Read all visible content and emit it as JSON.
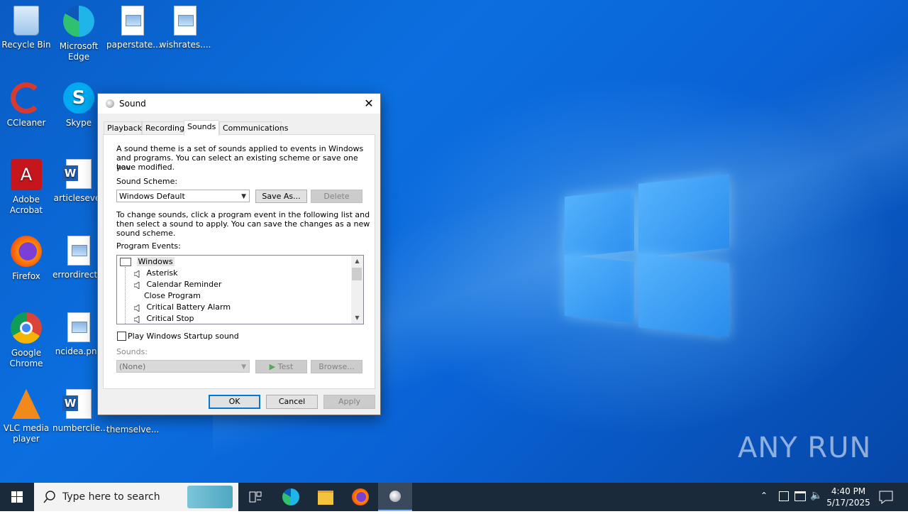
{
  "desktop": {
    "icons": [
      {
        "label": "Recycle Bin"
      },
      {
        "label": "Microsoft Edge"
      },
      {
        "label": "paperstate..."
      },
      {
        "label": "wishrates...."
      },
      {
        "label": "CCleaner"
      },
      {
        "label": "Skype"
      },
      {
        "label": "Adobe Acrobat"
      },
      {
        "label": "articlesever"
      },
      {
        "label": "Firefox"
      },
      {
        "label": "errordirect..."
      },
      {
        "label": "Google Chrome"
      },
      {
        "label": "ncidea.png"
      },
      {
        "label": "VLC media player"
      },
      {
        "label": "numberclie..."
      },
      {
        "label": "themselve..."
      }
    ],
    "watermark": "ANY RUN"
  },
  "dialog": {
    "title": "Sound",
    "close_glyph": "✕",
    "tabs": [
      {
        "label": "Playback"
      },
      {
        "label": "Recording"
      },
      {
        "label": "Sounds"
      },
      {
        "label": "Communications"
      }
    ],
    "intro_lines": [
      "A sound theme is a set of sounds applied to events in Windows",
      "and programs.  You can select an existing scheme or save one you",
      "have modified."
    ],
    "scheme_label": "Sound Scheme:",
    "scheme_value": "Windows Default",
    "save_as_label": "Save As...",
    "delete_label": "Delete",
    "change_lines": [
      "To change sounds, click a program event in the following list and",
      "then select a sound to apply.  You can save the changes as a new",
      "sound scheme."
    ],
    "events_label": "Program Events:",
    "events": [
      {
        "label": "Windows"
      },
      {
        "label": "Asterisk"
      },
      {
        "label": "Calendar Reminder"
      },
      {
        "label": "Close Program"
      },
      {
        "label": "Critical Battery Alarm"
      },
      {
        "label": "Critical Stop"
      }
    ],
    "startup_checkbox_label": "Play Windows Startup sound",
    "sounds_label": "Sounds:",
    "sounds_value": "(None)",
    "test_label": "Test",
    "browse_label": "Browse...",
    "ok_label": "OK",
    "cancel_label": "Cancel",
    "apply_label": "Apply"
  },
  "taskbar": {
    "search_placeholder": "Type here to search",
    "time": "4:40 PM",
    "date": "5/17/2025"
  }
}
